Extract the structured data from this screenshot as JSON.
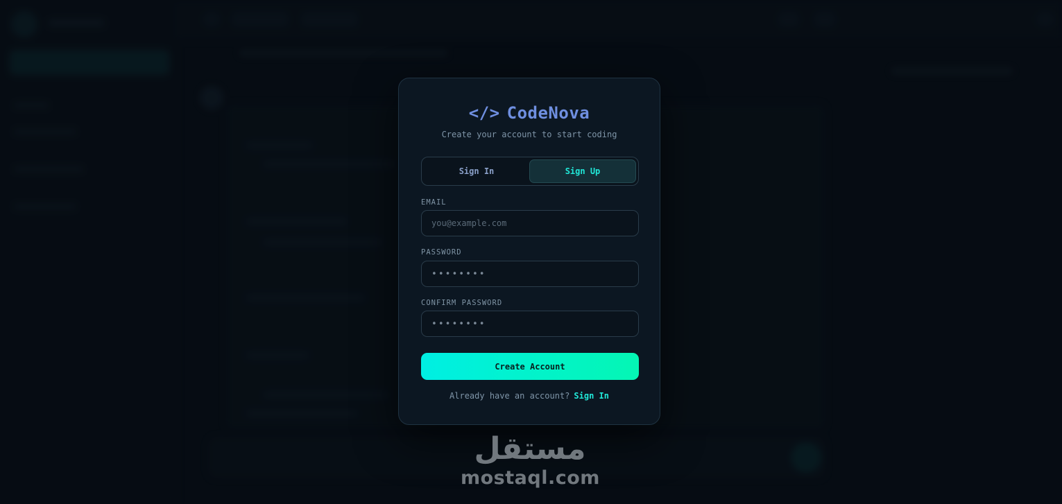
{
  "auth": {
    "brand_symbol": "</>",
    "brand_name": "CodeNova",
    "subtitle": "Create your account to start coding",
    "tabs": [
      {
        "label": "Sign In",
        "active": false
      },
      {
        "label": "Sign Up",
        "active": true
      }
    ],
    "email": {
      "label": "EMAIL",
      "placeholder": "you@example.com"
    },
    "password": {
      "label": "PASSWORD",
      "placeholder": "••••••••"
    },
    "confirm_password": {
      "label": "CONFIRM PASSWORD",
      "placeholder": "••••••••"
    },
    "submit_label": "Create Account",
    "footer_text": "Already have an account?",
    "footer_link": "Sign In"
  },
  "watermark": {
    "arabic": "مستقل",
    "latin": "mostaql.com"
  },
  "colors": {
    "accent": "#21e8d8",
    "brand": "#6f8fe0",
    "button_gradient_start": "#00efe3",
    "button_gradient_end": "#04f6b4"
  }
}
